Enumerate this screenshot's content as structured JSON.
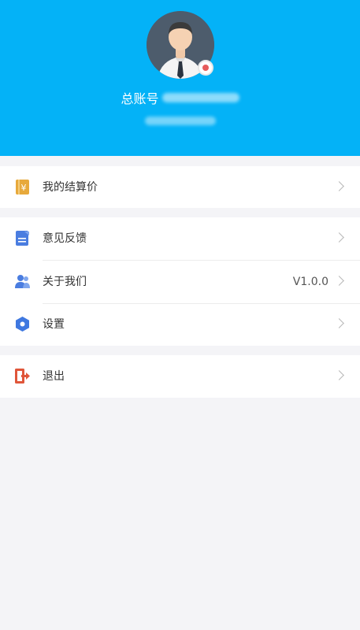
{
  "header": {
    "account_label": "总账号",
    "background_color": "#04b2f7",
    "avatar_icon": "person-avatar-icon"
  },
  "menu": {
    "group1": [
      {
        "label": "我的结算价",
        "icon": "settlement-price-icon"
      }
    ],
    "group2": [
      {
        "label": "意见反馈",
        "icon": "feedback-icon"
      },
      {
        "label": "关于我们",
        "icon": "about-us-icon",
        "value": "V1.0.0"
      },
      {
        "label": "设置",
        "icon": "settings-icon"
      }
    ],
    "group3": [
      {
        "label": "退出",
        "icon": "logout-icon"
      }
    ]
  },
  "colors": {
    "accent_blue": "#04b2f7",
    "settlement_icon": "#e7a93b",
    "feedback_icon": "#4a7de0",
    "settings_icon": "#3f78e0",
    "logout_icon": "#e0563a"
  }
}
